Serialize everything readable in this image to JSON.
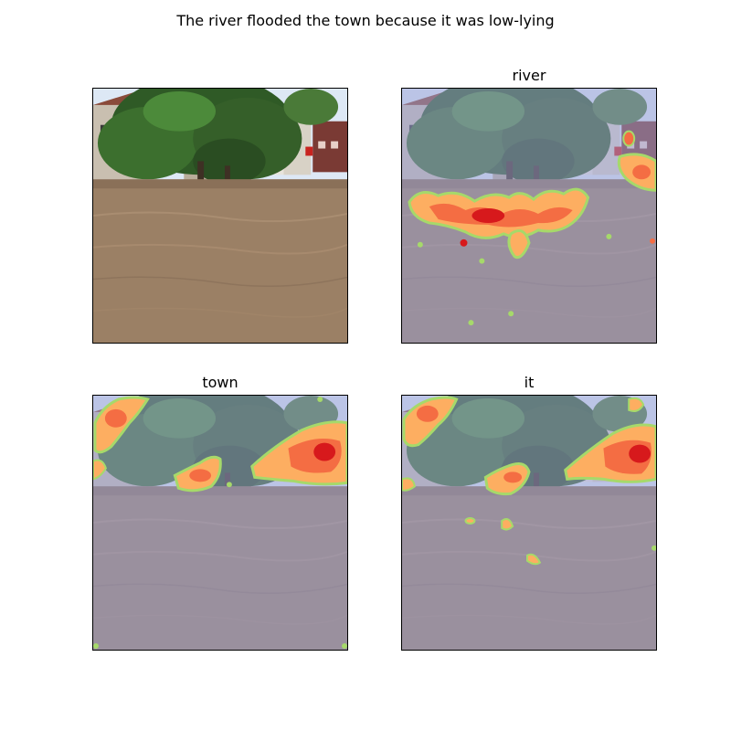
{
  "figure": {
    "title": "The river flooded the town because it was low-lying"
  },
  "panels": [
    {
      "title": "",
      "overlay": "none"
    },
    {
      "title": "river",
      "overlay": "attention-heatmap"
    },
    {
      "title": "town",
      "overlay": "attention-heatmap"
    },
    {
      "title": "it",
      "overlay": "attention-heatmap"
    }
  ],
  "colors": {
    "heat_hot": "#d7191c",
    "heat_warm": "#fdae61",
    "heat_edge": "#a6d96a",
    "tint": "#9aa0d8"
  }
}
